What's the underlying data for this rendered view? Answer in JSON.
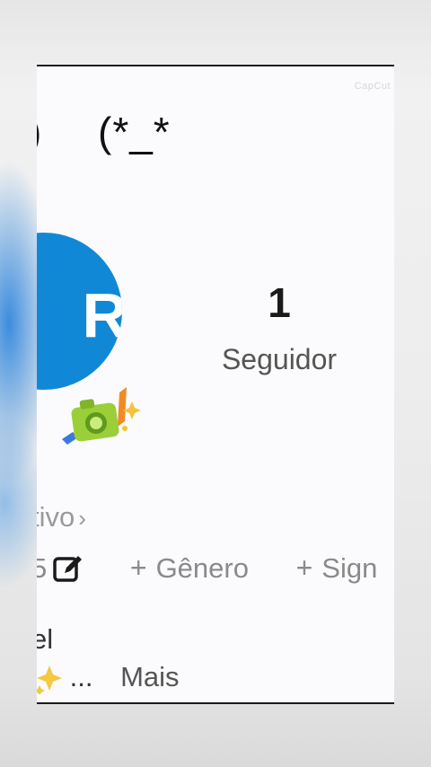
{
  "watermark": "CapCut",
  "header": {
    "partial_char": ")",
    "emoticon": "(*_*"
  },
  "avatar": {
    "letter": "R",
    "color": "#1188d6"
  },
  "stats": {
    "followers_count": "1",
    "followers_label": "Seguidor"
  },
  "profile": {
    "status_text": "tivo",
    "chips": {
      "partial_value": "5",
      "gender_label": "Gênero",
      "sign_label": "Sign"
    },
    "bio": {
      "line1": "el",
      "ellipsis": "...",
      "more_label": "Mais"
    }
  }
}
